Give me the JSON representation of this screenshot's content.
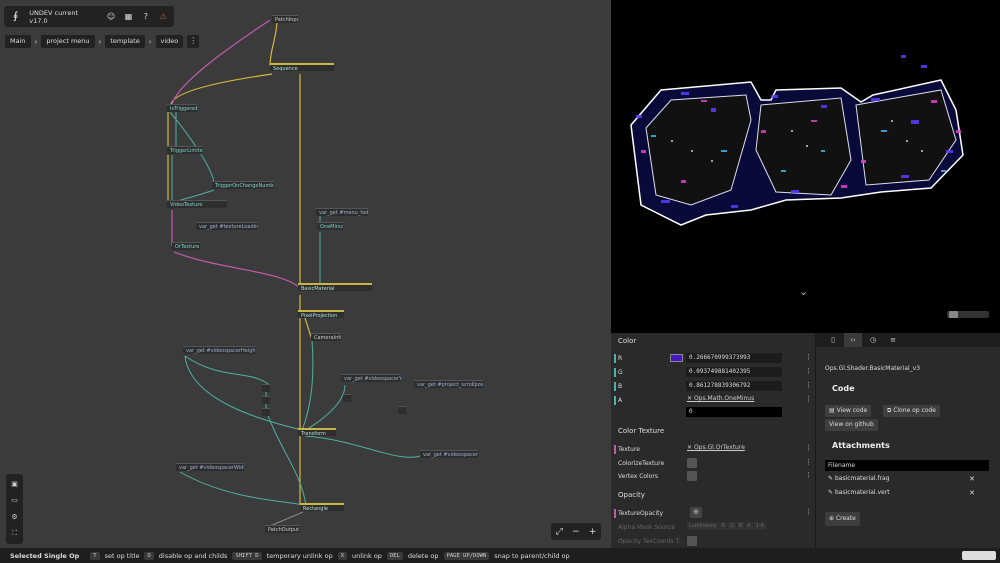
{
  "app": {
    "title": "UNDEV current v17.0",
    "icons": [
      "graph-logo-icon",
      "user-icon",
      "grid-icon",
      "help-icon",
      "warning-icon"
    ]
  },
  "breadcrumb": [
    "Main",
    "project menu",
    "template",
    "video"
  ],
  "ops": [
    {
      "name": "PatchInput",
      "style": "plain"
    },
    {
      "name": "Sequence",
      "style": "yellow"
    },
    {
      "name": "IsTriggered",
      "style": "teal"
    },
    {
      "name": "TriggerLimiter",
      "style": "teal"
    },
    {
      "name": "TriggerOnChangeNumber",
      "style": "teal"
    },
    {
      "name": "VideoTexture",
      "style": "teal"
    },
    {
      "name": "var_get  #textureLoading",
      "style": "var"
    },
    {
      "name": "OrTexture",
      "style": "teal"
    },
    {
      "name": "var_get  #menu_fade",
      "style": "var"
    },
    {
      "name": "OneMinus",
      "style": "teal"
    },
    {
      "name": "BasicMaterial",
      "style": "yellow"
    },
    {
      "name": "PixelProjection",
      "style": "yellow"
    },
    {
      "name": "CameraInfo",
      "style": "plain"
    },
    {
      "name": "var_get  #videospacerHeight",
      "style": "var"
    },
    {
      "name": "var_get  #videospacerY",
      "style": "var"
    },
    {
      "name": "var_get  #project_scrollpos",
      "style": "var"
    },
    {
      "name": "Transform",
      "style": "yellow"
    },
    {
      "name": "var_get  #videospacerX",
      "style": "var"
    },
    {
      "name": "var_get  #videospacerWidth",
      "style": "var"
    },
    {
      "name": "Rectangle",
      "style": "yellow"
    },
    {
      "name": "PatchOutput",
      "style": "plain"
    }
  ],
  "tools": [
    "save-icon",
    "record-icon",
    "settings-icon",
    "fullscreen-icon"
  ],
  "zoom_controls": [
    "⤢",
    "−",
    "+"
  ],
  "status": {
    "label": "Selected Single Op",
    "shortcuts": [
      {
        "key": "T",
        "desc": "set op title"
      },
      {
        "key": "D",
        "desc": "disable op and childs"
      },
      {
        "key": "SHIFT D",
        "desc": "temporary unlink op"
      },
      {
        "key": "X",
        "desc": "unlink op"
      },
      {
        "key": "DEL",
        "desc": "delete op"
      },
      {
        "key": "PAGE UP/DOWN",
        "desc": "snap to parent/child op"
      }
    ]
  },
  "viewport": {
    "chevron": "⌄"
  },
  "params": {
    "color_title": "Color",
    "r_label": "R",
    "r_value": "0.266670999373993",
    "g_label": "G",
    "g_value": "0.093749881402395",
    "b_label": "B",
    "b_value": "0.861278839306792",
    "a_label": "A",
    "a_link": "Ops.Math.OneMinus",
    "a_value": "0",
    "swatch_color": "#4418c9",
    "texture_title": "Color Texture",
    "texture_label": "Texture",
    "texture_link": "Ops.Gl.OrTexture",
    "colorize_label": "ColorizeTexture",
    "vertex_label": "Vertex Colors",
    "opacity_title": "Opacity",
    "tex_opacity_label": "TextureOpacity",
    "alpha_mask_label": "Alpha Mask Source",
    "alpha_mask_options": [
      "Luminance",
      "R",
      "G",
      "B",
      "A",
      "1-A"
    ],
    "opacity_coords_label": "Opacity TexCoords T..."
  },
  "info": {
    "op_name": "Ops.Gl.Shader.BasicMaterial_v3",
    "code_title": "Code",
    "view_code": "View code",
    "clone_code": "Clone op code",
    "view_github": "View on github",
    "attachments_title": "Attachments",
    "filename_header": "Filename",
    "files": [
      "basicmaterial.frag",
      "basicmaterial.vert"
    ],
    "create_label": "Create"
  }
}
